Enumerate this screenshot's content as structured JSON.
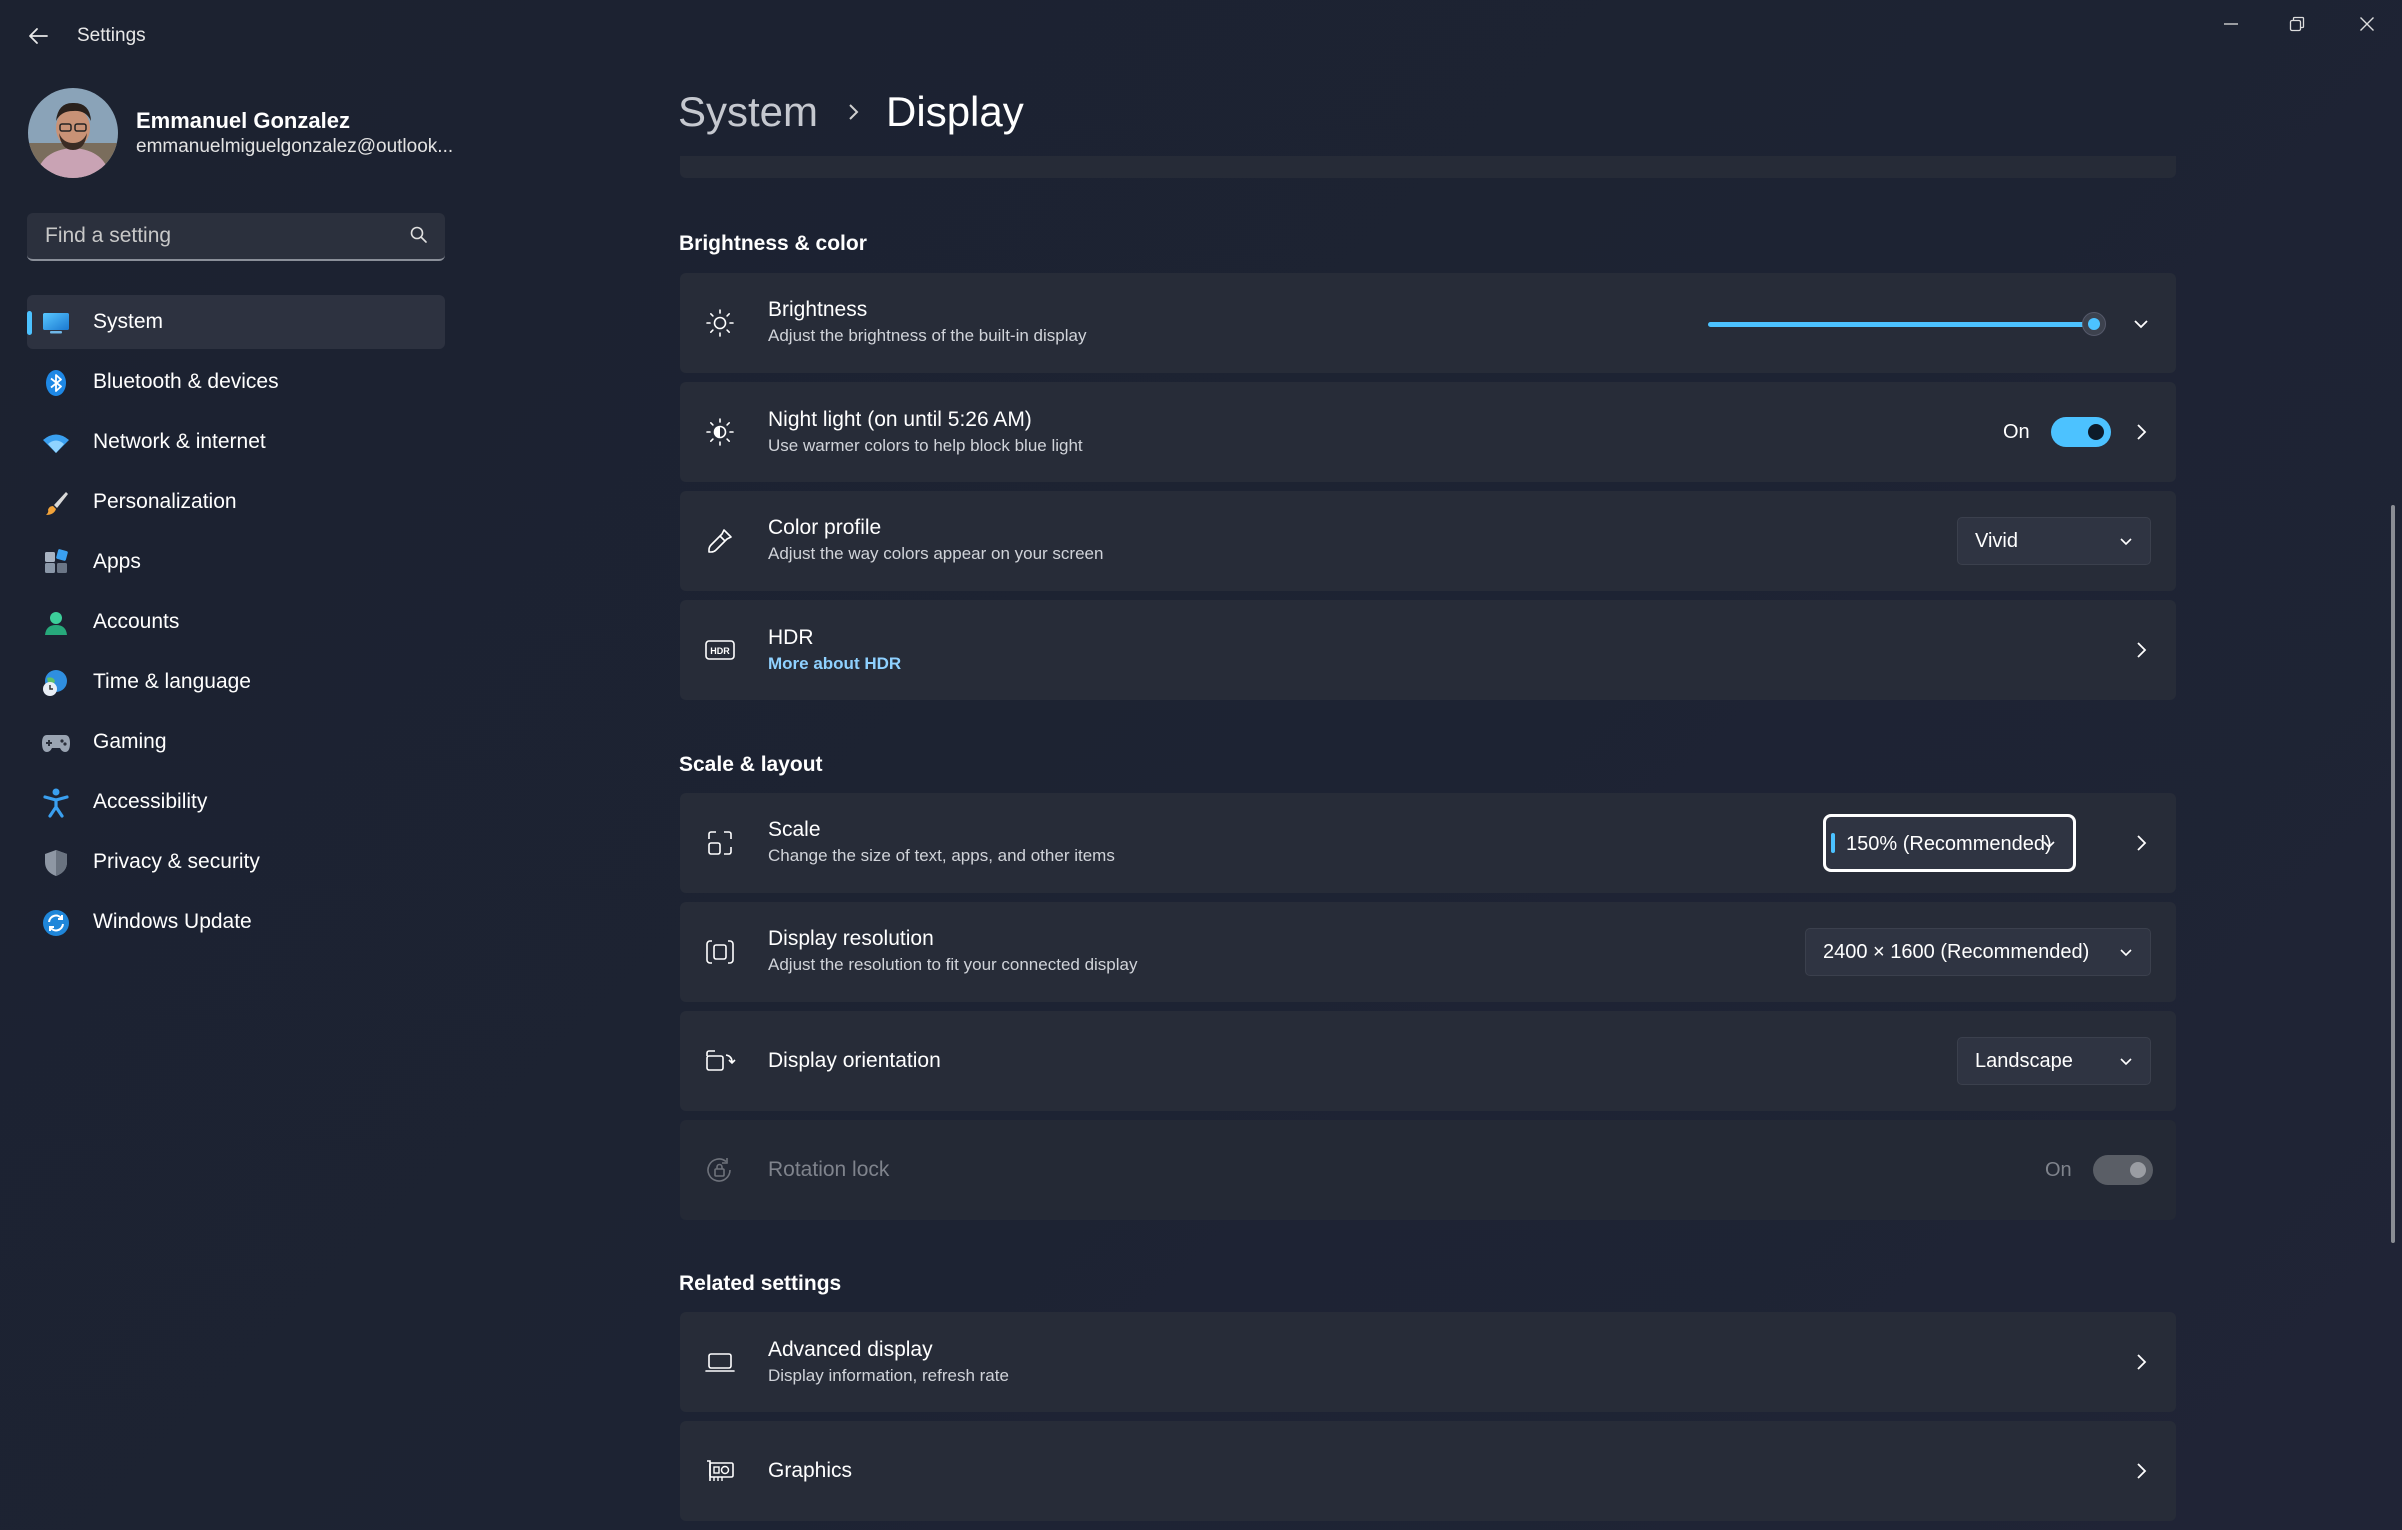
{
  "window": {
    "title": "Settings",
    "icons": {
      "back": "back-arrow-icon",
      "minimize": "minimize-icon",
      "maximize": "restore-icon",
      "close": "close-icon"
    }
  },
  "profile": {
    "name": "Emmanuel Gonzalez",
    "email": "emmanuelmiguelgonzalez@outlook..."
  },
  "search": {
    "placeholder": "Find a setting",
    "icon": "search-icon"
  },
  "nav": {
    "items": [
      {
        "label": "System",
        "icon": "monitor-icon",
        "active": true
      },
      {
        "label": "Bluetooth & devices",
        "icon": "bluetooth-icon"
      },
      {
        "label": "Network & internet",
        "icon": "wifi-icon"
      },
      {
        "label": "Personalization",
        "icon": "paintbrush-icon"
      },
      {
        "label": "Apps",
        "icon": "apps-icon"
      },
      {
        "label": "Accounts",
        "icon": "person-icon"
      },
      {
        "label": "Time & language",
        "icon": "globe-clock-icon"
      },
      {
        "label": "Gaming",
        "icon": "gamepad-icon"
      },
      {
        "label": "Accessibility",
        "icon": "accessibility-icon"
      },
      {
        "label": "Privacy & security",
        "icon": "shield-icon"
      },
      {
        "label": "Windows Update",
        "icon": "update-icon"
      }
    ]
  },
  "breadcrumb": {
    "parent": "System",
    "current": "Display"
  },
  "sections": {
    "brightness_color": "Brightness & color",
    "scale_layout": "Scale & layout",
    "related": "Related settings"
  },
  "brightness": {
    "title": "Brightness",
    "subtitle": "Adjust the brightness of the built-in display",
    "level": 1.0,
    "icon": "sun-icon"
  },
  "night_light": {
    "title": "Night light (on until 5:26 AM)",
    "subtitle": "Use warmer colors to help block blue light",
    "toggle_label": "On",
    "on": true,
    "icon": "night-light-icon"
  },
  "color_profile": {
    "title": "Color profile",
    "subtitle": "Adjust the way colors appear on your screen",
    "value": "Vivid",
    "icon": "eyedropper-icon"
  },
  "hdr": {
    "title": "HDR",
    "link": "More about HDR",
    "icon": "hdr-icon"
  },
  "scale": {
    "title": "Scale",
    "subtitle": "Change the size of text, apps, and other items",
    "value": "150% (Recommended)",
    "icon": "scale-icon"
  },
  "resolution": {
    "title": "Display resolution",
    "subtitle": "Adjust the resolution to fit your connected display",
    "value": "2400 × 1600 (Recommended)",
    "icon": "resolution-icon"
  },
  "orientation": {
    "title": "Display orientation",
    "value": "Landscape",
    "icon": "orientation-icon"
  },
  "rotation_lock": {
    "title": "Rotation lock",
    "toggle_label": "On",
    "on": true,
    "disabled": true,
    "icon": "rotation-lock-icon"
  },
  "advanced_display": {
    "title": "Advanced display",
    "subtitle": "Display information, refresh rate",
    "icon": "laptop-icon"
  },
  "graphics": {
    "title": "Graphics",
    "icon": "graphics-card-icon"
  },
  "colors": {
    "accent": "#4cc2ff",
    "background": "#1d2333",
    "card": "#272c38",
    "link": "#8fd1ff"
  }
}
